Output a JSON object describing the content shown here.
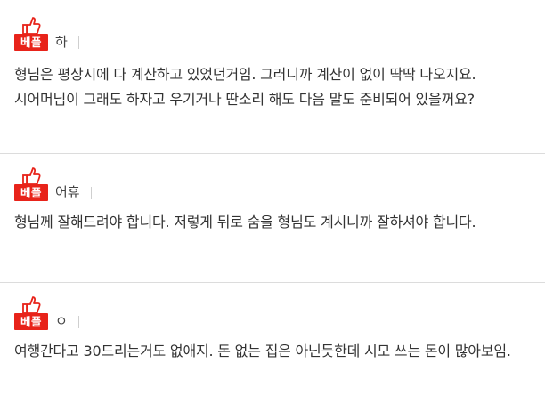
{
  "badge": {
    "label": "베플",
    "icon": "thumbs-up-icon",
    "color": "#e8231a"
  },
  "comments": [
    {
      "author": "하",
      "text": "형님은 평상시에 다 계산하고 있었던거임. 그러니까 계산이 없이 딱딱 나오지요. 시어머님이 그래도 하자고 우기거나 딴소리 해도 다음 말도 준비되어 있을꺼요?"
    },
    {
      "author": "어휴",
      "text": "형님께 잘해드려야 합니다. 저렇게 뒤로 숨을 형님도 계시니까 잘하셔야 합니다."
    },
    {
      "author": "ㅇ",
      "text": "여행간다고 30드리는거도 없애지. 돈 없는 집은 아닌듯한데 시모 쓰는 돈이 많아보임."
    }
  ]
}
